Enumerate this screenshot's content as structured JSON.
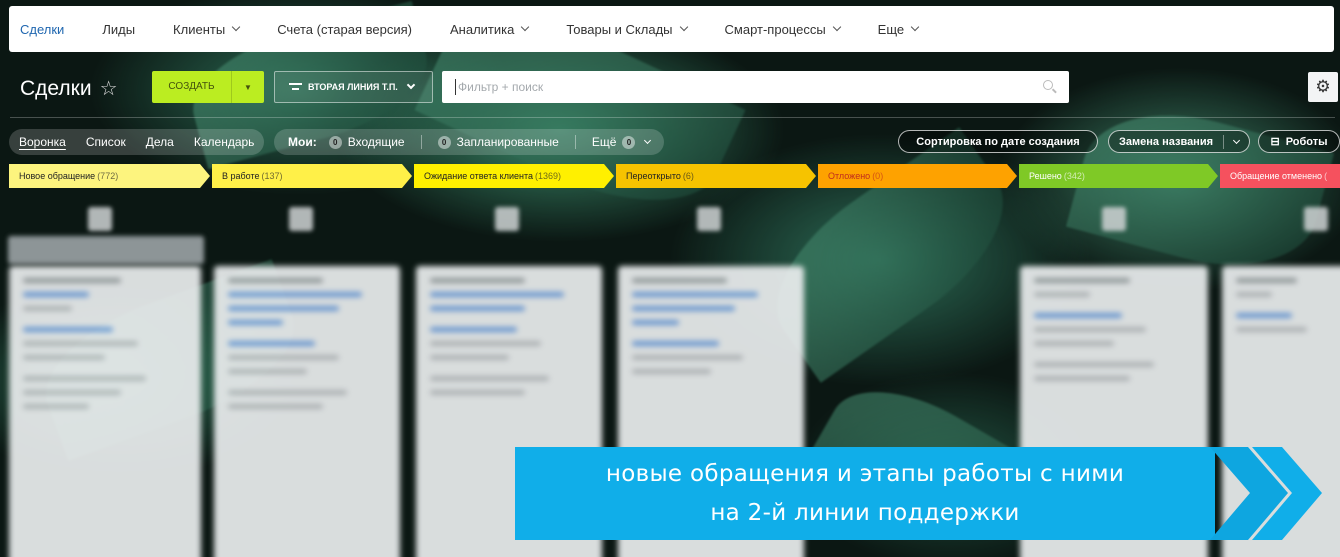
{
  "topnav": {
    "items": [
      {
        "label": "Сделки",
        "active": true,
        "dropdown": false
      },
      {
        "label": "Лиды",
        "active": false,
        "dropdown": false
      },
      {
        "label": "Клиенты",
        "active": false,
        "dropdown": true
      },
      {
        "label": "Счета (старая версия)",
        "active": false,
        "dropdown": false
      },
      {
        "label": "Аналитика",
        "active": false,
        "dropdown": true
      },
      {
        "label": "Товары и Склады",
        "active": false,
        "dropdown": true
      },
      {
        "label": "Смарт-процессы",
        "active": false,
        "dropdown": true
      },
      {
        "label": "Еще",
        "active": false,
        "dropdown": true
      }
    ]
  },
  "header": {
    "title": "Сделки",
    "create_label": "СОЗДАТЬ",
    "pipeline_label": "ВТОРАЯ ЛИНИЯ Т.П.",
    "search_placeholder": "Фильтр + поиск"
  },
  "views": {
    "items": [
      "Воронка",
      "Список",
      "Дела",
      "Календарь"
    ],
    "active": "Воронка"
  },
  "counters": {
    "label": "Мои:",
    "incoming_count": "0",
    "incoming_label": "Входящие",
    "planned_count": "0",
    "planned_label": "Запланированные",
    "more_label": "Ещё",
    "more_count": "0"
  },
  "actions": {
    "sort_label": "Сортировка по дате создания",
    "rename_label": "Замена названия",
    "robots_label": "Роботы"
  },
  "stages": [
    {
      "name": "Новое обращение",
      "count": "(772)",
      "color": "#fdf47e"
    },
    {
      "name": "В работе",
      "count": "(137)",
      "color": "#fff048"
    },
    {
      "name": "Ожидание ответа клиента",
      "count": "(1369)",
      "color": "#fff000"
    },
    {
      "name": "Переоткрыто",
      "count": "(6)",
      "color": "#f6c300"
    },
    {
      "name": "Отложено",
      "count": "(0)",
      "color": "#fea200"
    },
    {
      "name": "Решено",
      "count": "(342)",
      "color": "#7fc926"
    },
    {
      "name": "Обращение отменено",
      "count": "(",
      "color": "#f5515e"
    }
  ],
  "banner": {
    "line1": "новые обращения и этапы работы с ними",
    "line2": "на 2-й линии поддержки",
    "color": "#10aee9"
  }
}
